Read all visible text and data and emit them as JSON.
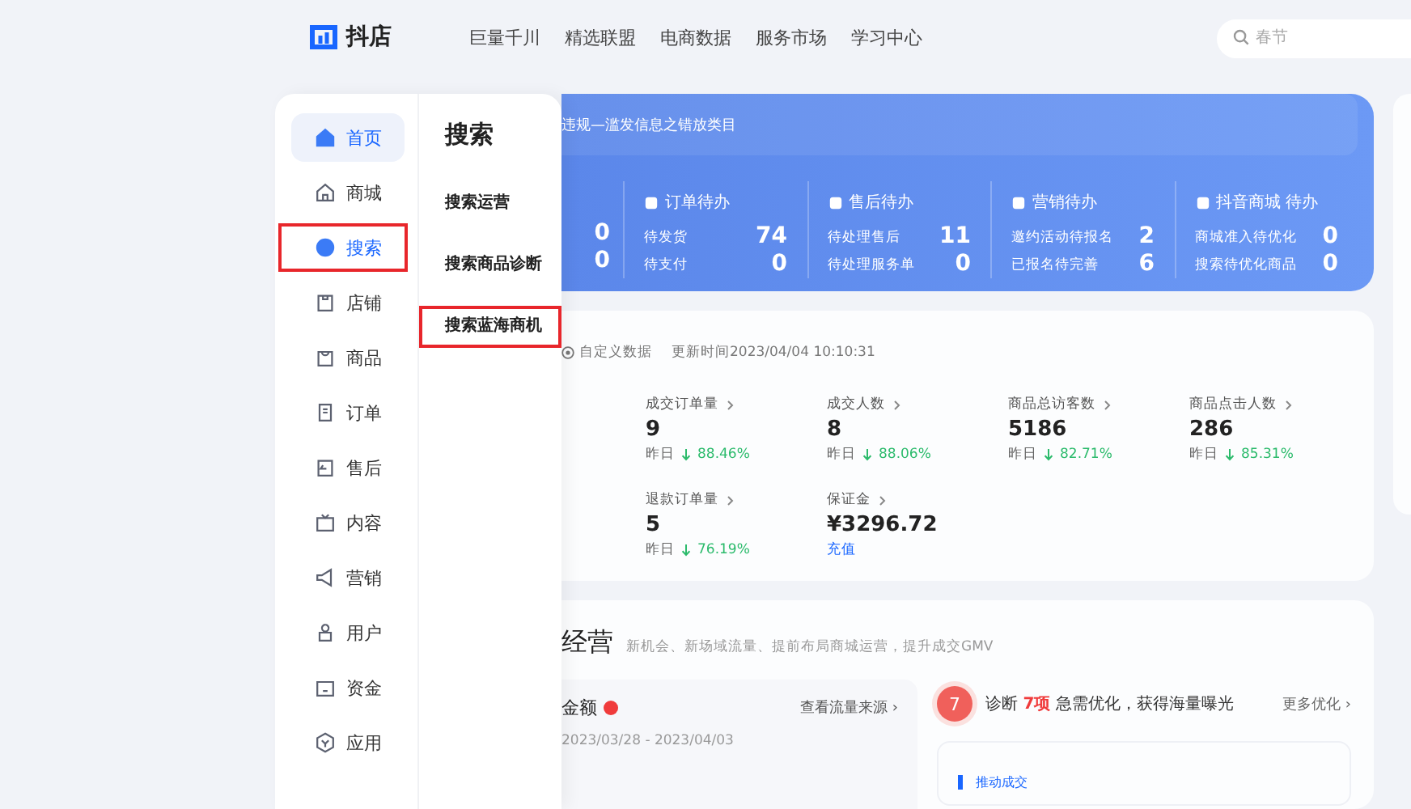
{
  "header": {
    "logo": "抖店",
    "nav": [
      "巨量千川",
      "精选联盟",
      "电商数据",
      "服务市场",
      "学习中心"
    ],
    "search": {
      "placeholder": "春节"
    }
  },
  "menu": {
    "items": [
      {
        "label": "首页",
        "selected": true,
        "highlighted": false
      },
      {
        "label": "商城",
        "selected": false,
        "highlighted": false
      },
      {
        "label": "搜索",
        "selected": false,
        "highlighted": true
      },
      {
        "label": "店铺",
        "selected": false,
        "highlighted": false
      },
      {
        "label": "商品",
        "selected": false,
        "highlighted": false
      },
      {
        "label": "订单",
        "selected": false,
        "highlighted": false
      },
      {
        "label": "售后",
        "selected": false,
        "highlighted": false
      },
      {
        "label": "内容",
        "selected": false,
        "highlighted": false
      },
      {
        "label": "营销",
        "selected": false,
        "highlighted": false
      },
      {
        "label": "用户",
        "selected": false,
        "highlighted": false
      },
      {
        "label": "资金",
        "selected": false,
        "highlighted": false
      },
      {
        "label": "应用",
        "selected": false,
        "highlighted": false
      }
    ],
    "submenu": {
      "title": "搜索",
      "items": [
        {
          "label": "搜索运营",
          "highlighted": false
        },
        {
          "label": "搜索商品诊断",
          "highlighted": false
        },
        {
          "label": "搜索蓝海商机",
          "highlighted": true
        }
      ]
    }
  },
  "todo": {
    "notice": "违规—滥发信息之错放类目",
    "first_values": [
      "0",
      "0"
    ],
    "groups": [
      {
        "title": "订单待办",
        "rows": [
          {
            "label": "待发货",
            "value": "74"
          },
          {
            "label": "待支付",
            "value": "0"
          }
        ]
      },
      {
        "title": "售后待办",
        "rows": [
          {
            "label": "待处理售后",
            "value": "11"
          },
          {
            "label": "待处理服务单",
            "value": "0"
          }
        ]
      },
      {
        "title": "营销待办",
        "rows": [
          {
            "label": "邀约活动待报名",
            "value": "2"
          },
          {
            "label": "已报名待完善",
            "value": "6"
          }
        ]
      },
      {
        "title": "抖音商城 待办",
        "rows": [
          {
            "label": "商城准入待优化",
            "value": "0"
          },
          {
            "label": "搜索待优化商品",
            "value": "0"
          }
        ]
      }
    ]
  },
  "data": {
    "custom": "自定义数据",
    "updated": "更新时间2023/04/04 10:10:31",
    "metrics": [
      {
        "label": "成交订单量",
        "value": "9",
        "compare": "昨日",
        "change": "88.46%"
      },
      {
        "label": "成交人数",
        "value": "8",
        "compare": "昨日",
        "change": "88.06%"
      },
      {
        "label": "商品总访客数",
        "value": "5186",
        "compare": "昨日",
        "change": "82.71%"
      },
      {
        "label": "商品点击人数",
        "value": "286",
        "compare": "昨日",
        "change": "85.31%"
      },
      {
        "label": "退款订单量",
        "value": "5",
        "compare": "昨日",
        "change": "76.19%"
      },
      {
        "label": "保证金",
        "value": "¥3296.72",
        "link": "充值"
      }
    ]
  },
  "business": {
    "title": "经营",
    "subtitle": "新机会、新场域流量、提前布局商城运营，提升成交GMV",
    "amount": {
      "title": "金额",
      "link": "查看流量来源 ›",
      "range": "2023/03/28 - 2023/04/03"
    },
    "diagnosis": {
      "count": "7",
      "text": "诊断 **7项** 急需优化，获得海量曝光",
      "more": "更多优化 ›",
      "tab": "推动成交"
    }
  }
}
